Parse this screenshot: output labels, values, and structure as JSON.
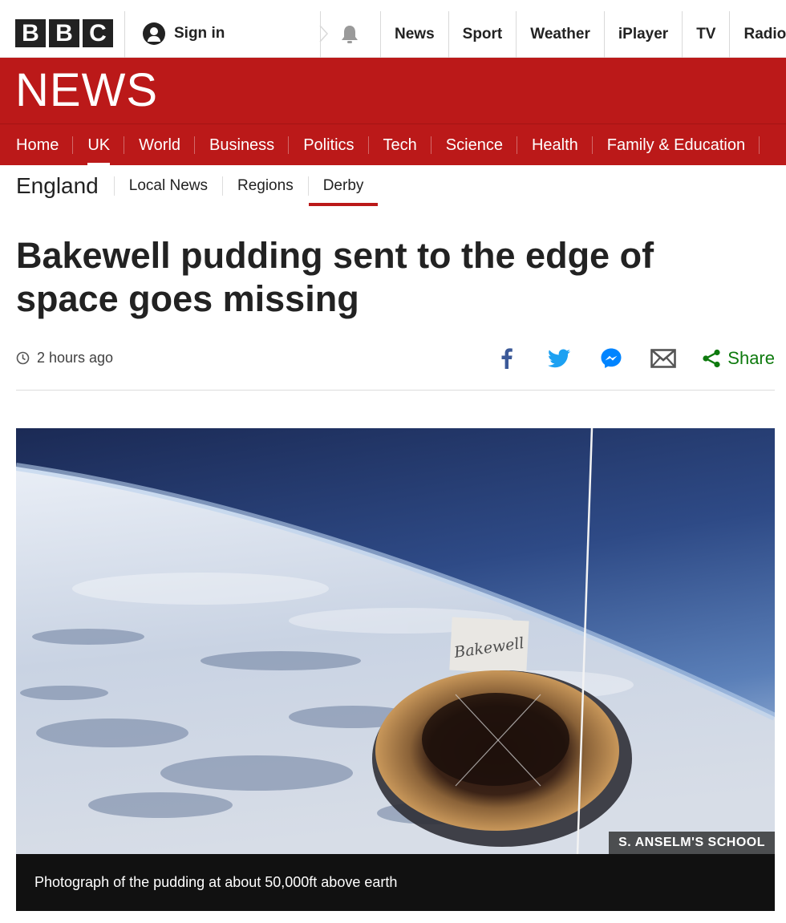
{
  "masthead": {
    "logo_letters": [
      "B",
      "B",
      "C"
    ],
    "sign_in": "Sign in",
    "nav": [
      "News",
      "Sport",
      "Weather",
      "iPlayer",
      "TV",
      "Radio"
    ]
  },
  "brand": {
    "wordmark": "NEWS",
    "red": "#bb1919"
  },
  "section_nav": {
    "items": [
      "Home",
      "UK",
      "World",
      "Business",
      "Politics",
      "Tech",
      "Science",
      "Health",
      "Family & Education"
    ],
    "active": "UK"
  },
  "sub_nav": {
    "region": "England",
    "items": [
      "Local News",
      "Regions",
      "Derby"
    ],
    "active": "Derby"
  },
  "article": {
    "headline": "Bakewell pudding sent to the edge of space goes missing",
    "timestamp": "2 hours ago",
    "share_label": "Share",
    "share_icons": [
      "facebook-icon",
      "twitter-icon",
      "messenger-icon",
      "email-icon",
      "share-icon"
    ],
    "image": {
      "label_text": "Bakewell",
      "credit": "S. ANSELM'S SCHOOL",
      "caption": "Photograph of the pudding at about 50,000ft above earth"
    }
  }
}
